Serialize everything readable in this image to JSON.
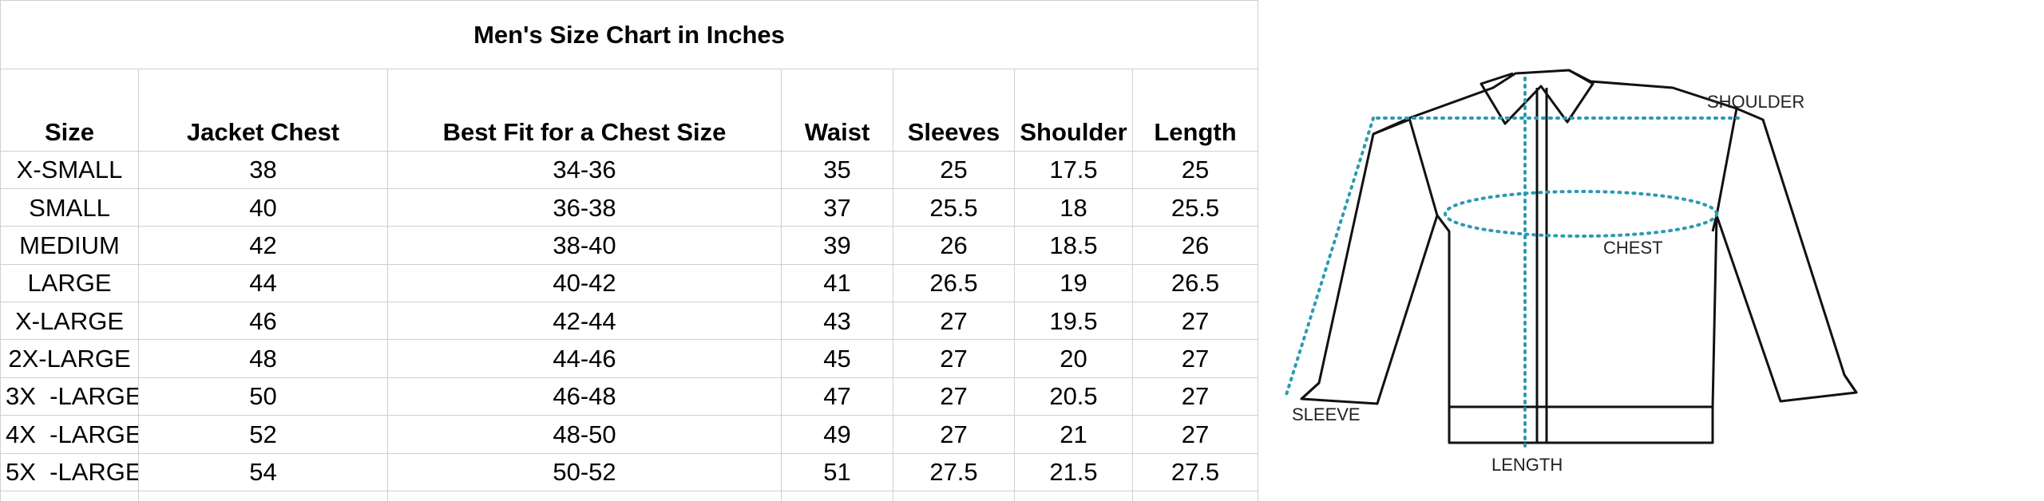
{
  "title": "Men's Size Chart in Inches",
  "columns": [
    "Size",
    "Jacket Chest",
    "Best Fit for a Chest Size",
    "Waist",
    "Sleeves",
    "Shoulder",
    "Length"
  ],
  "rows": [
    [
      "X-SMALL",
      "38",
      "34-36",
      "35",
      "25",
      "17.5",
      "25"
    ],
    [
      "SMALL",
      "40",
      "36-38",
      "37",
      "25.5",
      "18",
      "25.5"
    ],
    [
      "MEDIUM",
      "42",
      "38-40",
      "39",
      "26",
      "18.5",
      "26"
    ],
    [
      "LARGE",
      "44",
      "40-42",
      "41",
      "26.5",
      "19",
      "26.5"
    ],
    [
      "X-LARGE",
      "46",
      "42-44",
      "43",
      "27",
      "19.5",
      "27"
    ],
    [
      "2X-LARGE",
      "48",
      "44-46",
      "45",
      "27",
      "20",
      "27"
    ],
    [
      "3X  -LARGE",
      "50",
      "46-48",
      "47",
      "27",
      "20.5",
      "27"
    ],
    [
      "4X  -LARGE",
      "52",
      "48-50",
      "49",
      "27",
      "21",
      "27"
    ],
    [
      "5X  -LARGE",
      "54",
      "50-52",
      "51",
      "27.5",
      "21.5",
      "27.5"
    ]
  ],
  "diagram": {
    "shoulder_label": "SHOULDER",
    "chest_label": "CHEST",
    "sleeve_label": "SLEEVE",
    "length_label": "LENGTH"
  },
  "colors": {
    "grid": "#d0d0d0",
    "measure_dots": "#2a9bb0",
    "outline": "#111111"
  }
}
